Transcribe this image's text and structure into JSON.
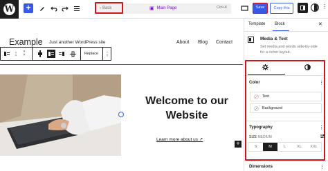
{
  "topbar": {
    "logo_letter": "W",
    "add_label": "+",
    "back_label": "Back",
    "doc_title": "Main Page",
    "shortcut": "Ctrl+K",
    "save_label": "Save",
    "copy_label": "Copy this",
    "more": "⋮"
  },
  "site": {
    "title": "Example",
    "tagline": "Just another WordPress site",
    "nav": [
      "About",
      "Blog",
      "Contact"
    ]
  },
  "block_toolbar": {
    "replace_label": "Replace",
    "more": "⋮"
  },
  "content": {
    "heading": "Welcome to our Website",
    "link": "Learn more about us ↗",
    "add_block": "+"
  },
  "sidebar": {
    "tabs": [
      "Template",
      "Block"
    ],
    "close": "✕",
    "block_name": "Media & Text",
    "block_desc": "Set media and words side-by-side for a richer layout.",
    "color_heading": "Color",
    "color_items": [
      "Text",
      "Background"
    ],
    "typography_heading": "Typography",
    "size_label": "SIZE",
    "size_value": "MEDIUM",
    "size_options": [
      "S",
      "M",
      "L",
      "XL",
      "XXL"
    ],
    "size_selected": "M",
    "dimensions_heading": "Dimensions",
    "more": "⋮"
  },
  "colors": {
    "accent": "#3858e9",
    "highlight": "#d1131c",
    "dark": "#1e1e1e"
  }
}
